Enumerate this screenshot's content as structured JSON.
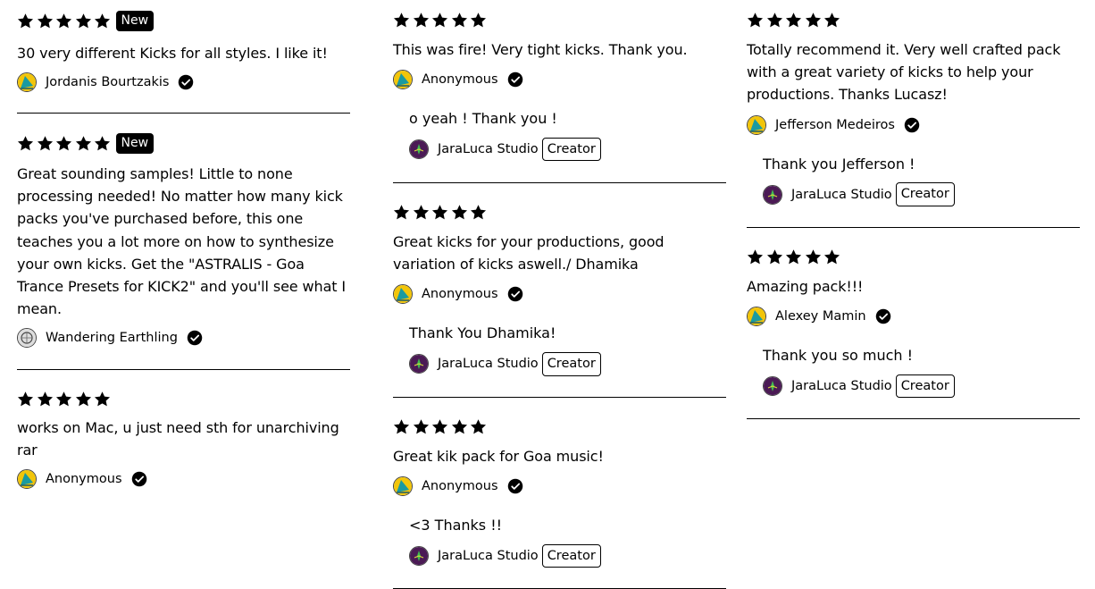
{
  "reviews_col1": [
    {
      "text": "30 very different Kicks for all styles. I like it!",
      "author": "Jordanis Bourtzakis",
      "badge": "New",
      "avatar": "brand-avatar"
    },
    {
      "text": "Great sounding samples! Little to none processing needed! No matter how many kick packs you've purchased before, this one teaches you a lot more on how to synthesize your own kicks. Get the \"ASTRALIS - Goa Trance Presets for KICK2\" and you'll see what I mean.",
      "author": "Wandering Earthling",
      "badge": "New",
      "avatar": "earth-avatar"
    },
    {
      "text": "works on Mac, u just need sth for unarchiving rar",
      "author": "Anonymous",
      "avatar": "brand-avatar"
    }
  ],
  "reviews_col2": [
    {
      "text": "This was fire! Very tight kicks. Thank you.",
      "author": "Anonymous",
      "reply": "o yeah ! Thank you !",
      "avatar": "brand-avatar"
    },
    {
      "text": "Great kicks for your productions, good variation of kicks aswell./ Dhamika",
      "author": "Anonymous",
      "reply": "Thank You Dhamika!",
      "avatar": "brand-avatar"
    },
    {
      "text": "Great kik pack for Goa music!",
      "author": "Anonymous",
      "reply": "<3 Thanks !!",
      "avatar": "brand-avatar"
    }
  ],
  "reviews_col3": [
    {
      "text": "Totally recommend it. Very well crafted pack with a great variety of kicks to help your productions. Thanks Lucasz!",
      "author": "Jefferson Medeiros",
      "reply": "Thank you Jefferson !",
      "avatar": "brand-avatar"
    },
    {
      "text": "Amazing pack!!!",
      "author": "Alexey Mamin",
      "reply": "Thank you so much !",
      "avatar": "brand-avatar"
    }
  ],
  "creator": {
    "name": "JaraLuca Studio",
    "badge": "Creator"
  },
  "rating": {
    "stars": 5,
    "max": 5
  },
  "colors": {
    "star": "#000000",
    "badge_bg": "#000000",
    "badge_fg": "#ffffff",
    "divider": "#000000",
    "brand_teal": "#1a9aa0",
    "brand_yellow": "#f2c50a",
    "creator_purple": "#4b1a55"
  }
}
